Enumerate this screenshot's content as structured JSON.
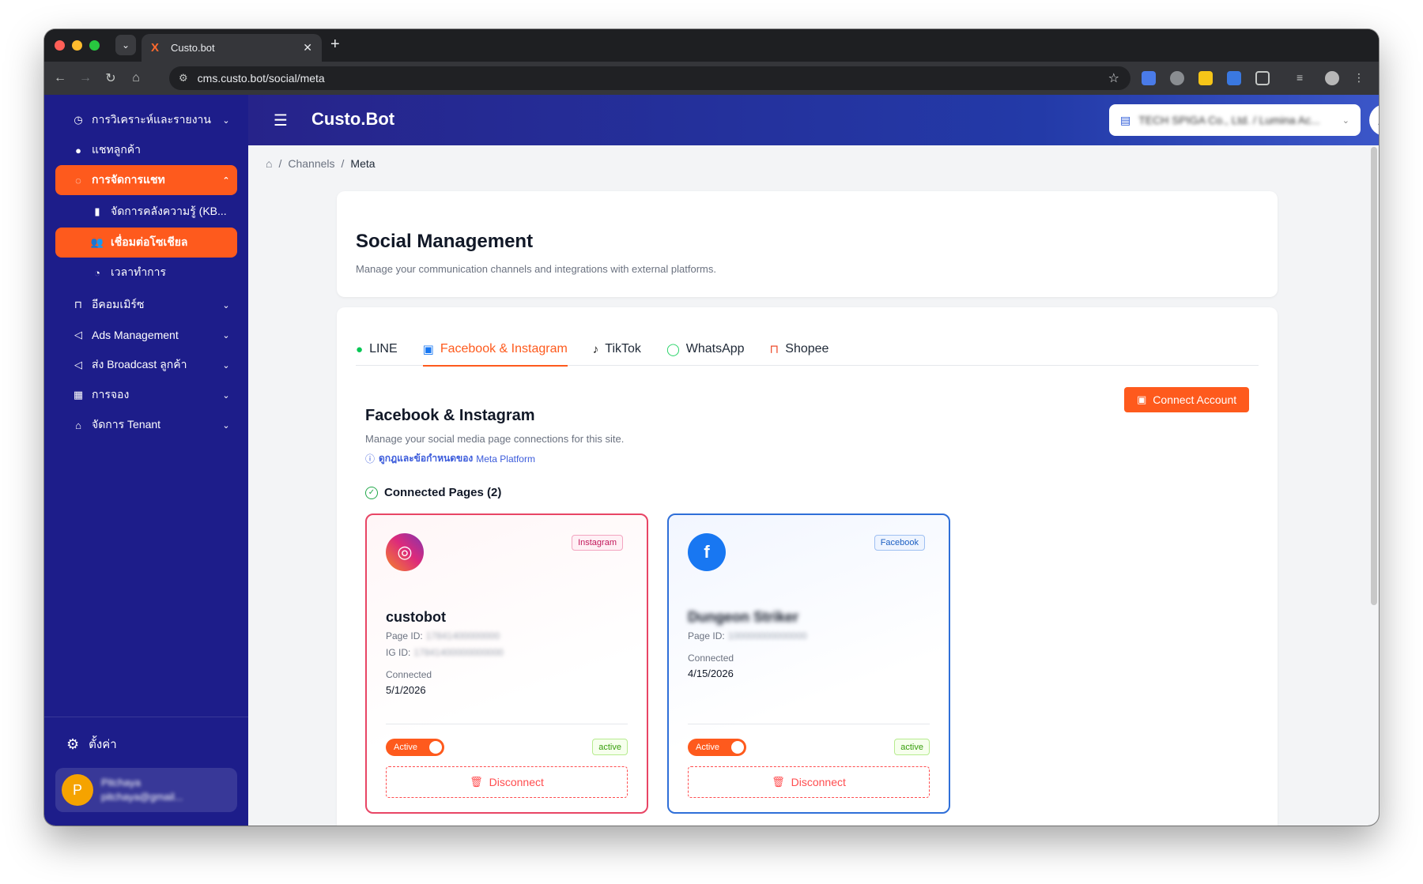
{
  "browser": {
    "tab_title": "Custo.bot",
    "url": "cms.custo.bot/social/meta"
  },
  "sidebar": {
    "items": [
      {
        "label": "การวิเคราะห์และรายงาน",
        "icon": "dashboard-icon"
      },
      {
        "label": "แชทลูกค้า",
        "icon": "chat-icon"
      },
      {
        "label": "การจัดการแชท",
        "icon": "message-icon"
      },
      {
        "label": "จัดการคลังความรู้ (KB...",
        "icon": "book-icon"
      },
      {
        "label": "เชื่อมต่อโซเชียล",
        "icon": "team-icon"
      },
      {
        "label": "เวลาทำการ",
        "icon": "clock-icon"
      },
      {
        "label": "อีคอมเมิร์ซ",
        "icon": "shopping-bag-icon"
      },
      {
        "label": "Ads Management",
        "icon": "megaphone-icon"
      },
      {
        "label": "ส่ง Broadcast ลูกค้า",
        "icon": "megaphone-icon"
      },
      {
        "label": "การจอง",
        "icon": "calendar-icon"
      },
      {
        "label": "จัดการ Tenant",
        "icon": "home-icon"
      }
    ],
    "settings_label": "ตั้งค่า",
    "user": {
      "initial": "P",
      "name": "Pitchaya",
      "email": "pitchaya@gmail..."
    }
  },
  "topbar": {
    "brand": "Custo.Bot",
    "tenant": "TECH SPIGA Co., Ltd. / Lumina Ac..."
  },
  "breadcrumb": {
    "items": [
      "Channels",
      "Meta"
    ]
  },
  "header": {
    "title": "Social Management",
    "description": "Manage your communication channels and integrations with external platforms."
  },
  "tabs": [
    {
      "label": "LINE",
      "icon": "line-icon"
    },
    {
      "label": "Facebook & Instagram",
      "icon": "facebook-icon"
    },
    {
      "label": "TikTok",
      "icon": "tiktok-icon"
    },
    {
      "label": "WhatsApp",
      "icon": "whatsapp-icon"
    },
    {
      "label": "Shopee",
      "icon": "shopee-icon"
    }
  ],
  "section": {
    "title": "Facebook & Instagram",
    "description": "Manage your social media page connections for this site.",
    "rules_strong": "ดูกฎและข้อกำหนดของ",
    "rules_link": "Meta Platform",
    "connect_button": "Connect Account",
    "connected_title": "Connected Pages (2)"
  },
  "pages": [
    {
      "badge": "Instagram",
      "name": "custobot",
      "page_id_label": "Page ID:",
      "page_id": "17841400000000",
      "ig_id_label": "IG ID:",
      "ig_id": "17841400000000000",
      "connected_label": "Connected",
      "connected_date": "5/1/2026",
      "toggle_label": "Active",
      "status": "active",
      "disconnect_label": "Disconnect"
    },
    {
      "badge": "Facebook",
      "name": "Dungeon Striker",
      "page_id_label": "Page ID:",
      "page_id": "100000000000000",
      "connected_label": "Connected",
      "connected_date": "4/15/2026",
      "toggle_label": "Active",
      "status": "active",
      "disconnect_label": "Disconnect"
    }
  ],
  "colors": {
    "accent": "#fe5a1d",
    "sidebar": "#1d1d8a",
    "instagram_border": "#e84565",
    "facebook_border": "#2f6fd8"
  }
}
